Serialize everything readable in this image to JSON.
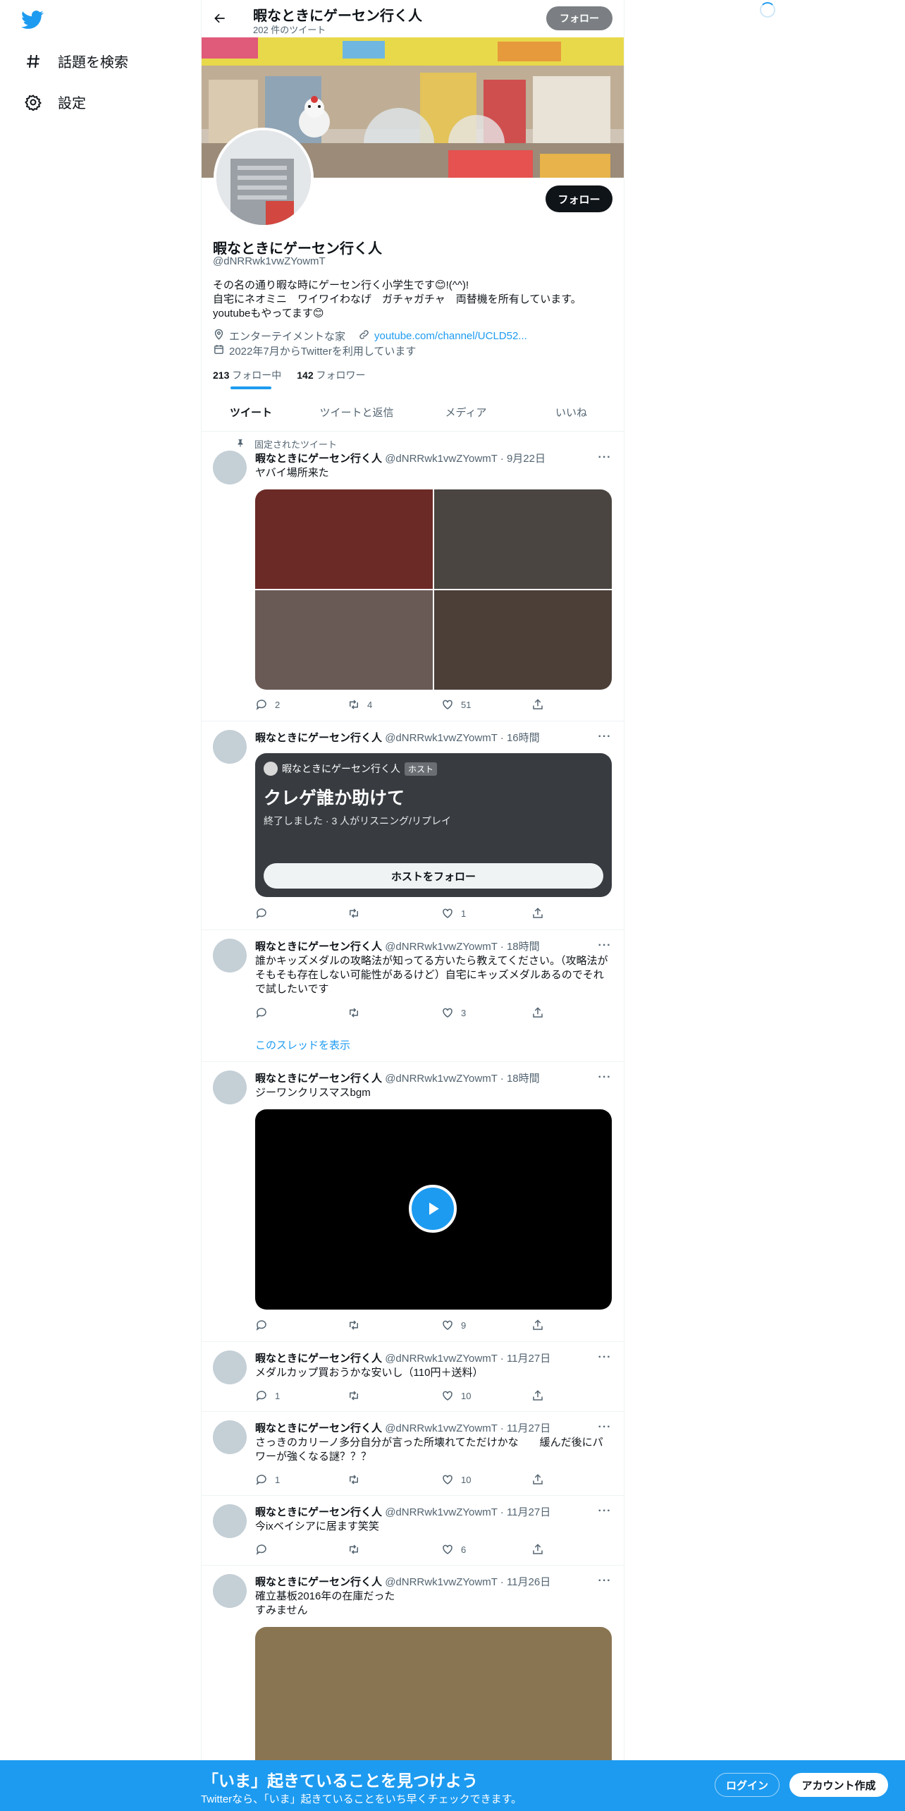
{
  "nav": {
    "items": [
      {
        "label": "話題を検索",
        "icon": "hashtag-icon"
      },
      {
        "label": "設定",
        "icon": "gear-icon"
      }
    ]
  },
  "header": {
    "title": "暇なときにゲーセン行く人",
    "subtitle": "202 件のツイート",
    "follow_label": "フォロー"
  },
  "profile": {
    "name": "暇なときにゲーセン行く人",
    "handle": "@dNRRwk1vwZYowmT",
    "follow_label": "フォロー",
    "bio_lines": [
      "その名の通り暇な時にゲーセン行く小学生です😊!(^^)!",
      "自宅にネオミニ　ワイワイわなげ　ガチャガチャ　両替機を所有しています。",
      "youtubeもやってます😊"
    ],
    "location": "エンターテイメントな家",
    "url": "youtube.com/channel/UCLD52...",
    "joined": "2022年7月からTwitterを利用しています",
    "following_count": "213",
    "following_label": "フォロー中",
    "followers_count": "142",
    "followers_label": "フォロワー"
  },
  "tabs": [
    "ツイート",
    "ツイートと返信",
    "メディア",
    "いいね"
  ],
  "tweets": [
    {
      "pinned_label": "固定されたツイート",
      "name": "暇なときにゲーセン行く人",
      "meta": "@dNRRwk1vwZYowmT · 9月22日",
      "text": "ヤバイ場所来た",
      "media_colors": [
        "#6b2a26",
        "#4a4540",
        "#6a5a55",
        "#4b3f38"
      ],
      "reply": "2",
      "retweet": "4",
      "like": "51"
    },
    {
      "name": "暇なときにゲーセン行く人",
      "meta": "@dNRRwk1vwZYowmT · 16時間",
      "space": {
        "host": "暇なときにゲーセン行く人",
        "host_badge": "ホスト",
        "title": "クレゲ誰か助けて",
        "status": "終了しました · 3 人がリスニング/リプレイ",
        "button": "ホストをフォロー"
      },
      "reply": "",
      "retweet": "",
      "like": "1"
    },
    {
      "name": "暇なときにゲーセン行く人",
      "meta": "@dNRRwk1vwZYowmT · 18時間",
      "text": "誰かキッズメダルの攻略法が知ってる方いたら教えてください。（攻略法がそもそも存在しない可能性があるけど）自宅にキッズメダルあるのでそれで試したいです",
      "reply": "",
      "retweet": "",
      "like": "3",
      "thread_label": "このスレッドを表示"
    },
    {
      "name": "暇なときにゲーセン行く人",
      "meta": "@dNRRwk1vwZYowmT · 18時間",
      "text": "ジーワンクリスマスbgm",
      "reply": "",
      "retweet": "",
      "like": "9"
    },
    {
      "name": "暇なときにゲーセン行く人",
      "meta": "@dNRRwk1vwZYowmT · 11月27日",
      "text": "メダルカップ買おうかな安いし（110円＋送料）",
      "reply": "1",
      "retweet": "",
      "like": "10"
    },
    {
      "name": "暇なときにゲーセン行く人",
      "meta": "@dNRRwk1vwZYowmT · 11月27日",
      "text": "さっきのカリーノ多分自分が言った所壊れてただけかな　　緩んだ後にパワーが強くなる謎？？？",
      "reply": "1",
      "retweet": "",
      "like": "10"
    },
    {
      "name": "暇なときにゲーセン行く人",
      "meta": "@dNRRwk1vwZYowmT · 11月27日",
      "text": "今ixベイシアに居ます笑笑",
      "reply": "",
      "retweet": "",
      "like": "6"
    },
    {
      "name": "暇なときにゲーセン行く人",
      "meta": "@dNRRwk1vwZYowmT · 11月26日",
      "text": "確立基板2016年の在庫だった\nすみません",
      "media_color": "#8a7553"
    }
  ],
  "bottom_bar": {
    "headline": "「いま」起きていることを見つけよう",
    "subline": "Twitterなら、「いま」起きていることをいち早くチェックできます。",
    "login": "ログイン",
    "signup": "アカウント作成"
  },
  "colors": {
    "accent": "#1d9bf0",
    "text": "#0f1419",
    "muted": "#536471"
  }
}
